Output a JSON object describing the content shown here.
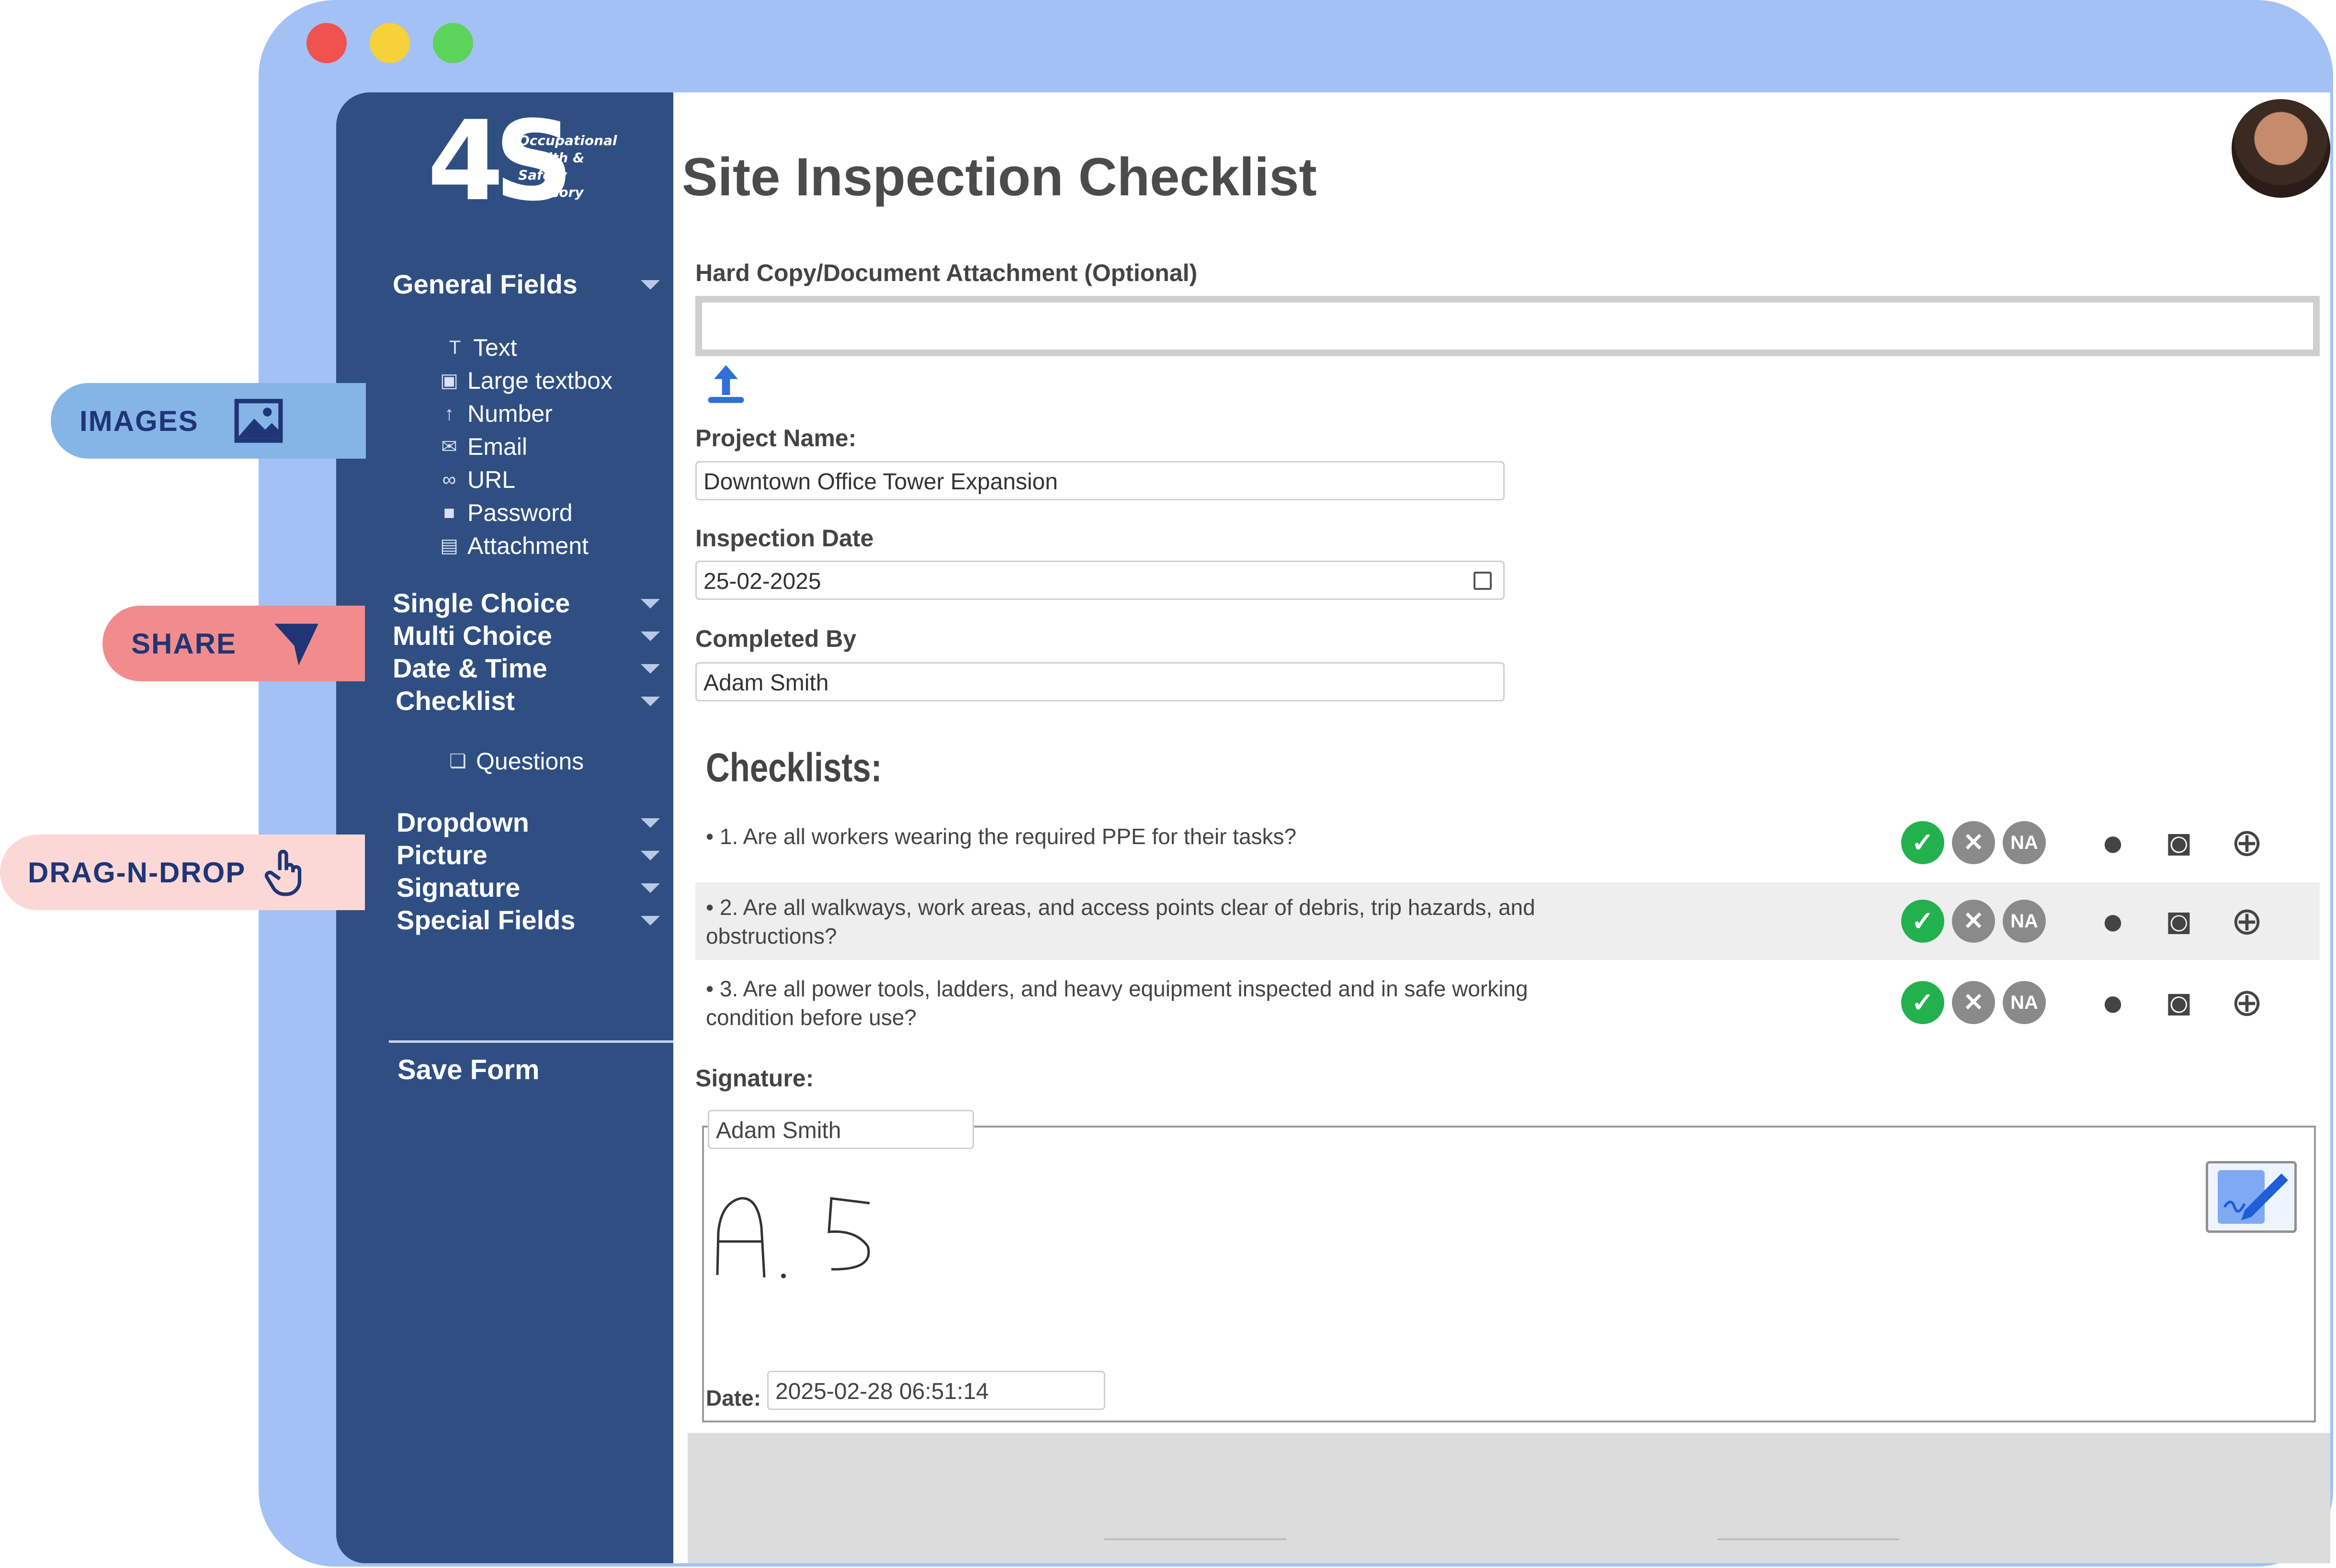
{
  "window": {
    "title": "Site Inspection Checklist"
  },
  "logo": {
    "mark": "4S",
    "lines": [
      "Occupational",
      "Health &",
      "Safety",
      "Advisory"
    ]
  },
  "sidebar": {
    "groups_top": [
      {
        "label": "General Fields"
      }
    ],
    "general_fields": [
      {
        "label": "Text",
        "icon": "text-icon"
      },
      {
        "label": "Large textbox",
        "icon": "textbox-icon"
      },
      {
        "label": "Number",
        "icon": "number-icon"
      },
      {
        "label": "Email",
        "icon": "email-icon"
      },
      {
        "label": "URL",
        "icon": "link-icon"
      },
      {
        "label": "Password",
        "icon": "lock-icon"
      },
      {
        "label": "Attachment",
        "icon": "attachment-icon"
      }
    ],
    "groups_mid": [
      {
        "label": "Single Choice"
      },
      {
        "label": "Multi Choice"
      },
      {
        "label": "Date & Time"
      },
      {
        "label": "Checklist"
      }
    ],
    "checklist_sub": {
      "label": "Questions",
      "icon": "questions-icon"
    },
    "groups_bottom": [
      {
        "label": "Dropdown"
      },
      {
        "label": "Picture"
      },
      {
        "label": "Signature"
      },
      {
        "label": "Special Fields"
      }
    ],
    "save_label": "Save Form"
  },
  "pills": {
    "images": "IMAGES",
    "share": "SHARE",
    "drag": "DRAG-N-DROP"
  },
  "form": {
    "attachment_label": "Hard Copy/Document Attachment (Optional)",
    "project_label": "Project Name:",
    "project_value": "Downtown Office Tower Expansion",
    "date_label": "Inspection Date",
    "date_value": "25-02-2025",
    "completed_label": "Completed By",
    "completed_value": "Adam Smith",
    "checklists_heading": "Checklists:",
    "questions": [
      {
        "text": "1. Are all workers wearing the required PPE for their tasks?"
      },
      {
        "text": "2. Are all walkways, work areas, and access points clear of debris, trip hazards, and obstructions?"
      },
      {
        "text": "3. Are all power tools, ladders, and heavy equipment inspected and in safe working condition before use?"
      }
    ],
    "na_label": "NA",
    "signature_label": "Signature:",
    "signature_name": "Adam Smith",
    "signature_drawing": "A.S",
    "date_sig_label": "Date:",
    "date_sig_value": "2025-02-28 06:51:14"
  },
  "colors": {
    "sidebar": "#2f4f83",
    "frame": "#a3c1f5",
    "ok": "#22b14c",
    "neutral": "#8a8a8a"
  }
}
